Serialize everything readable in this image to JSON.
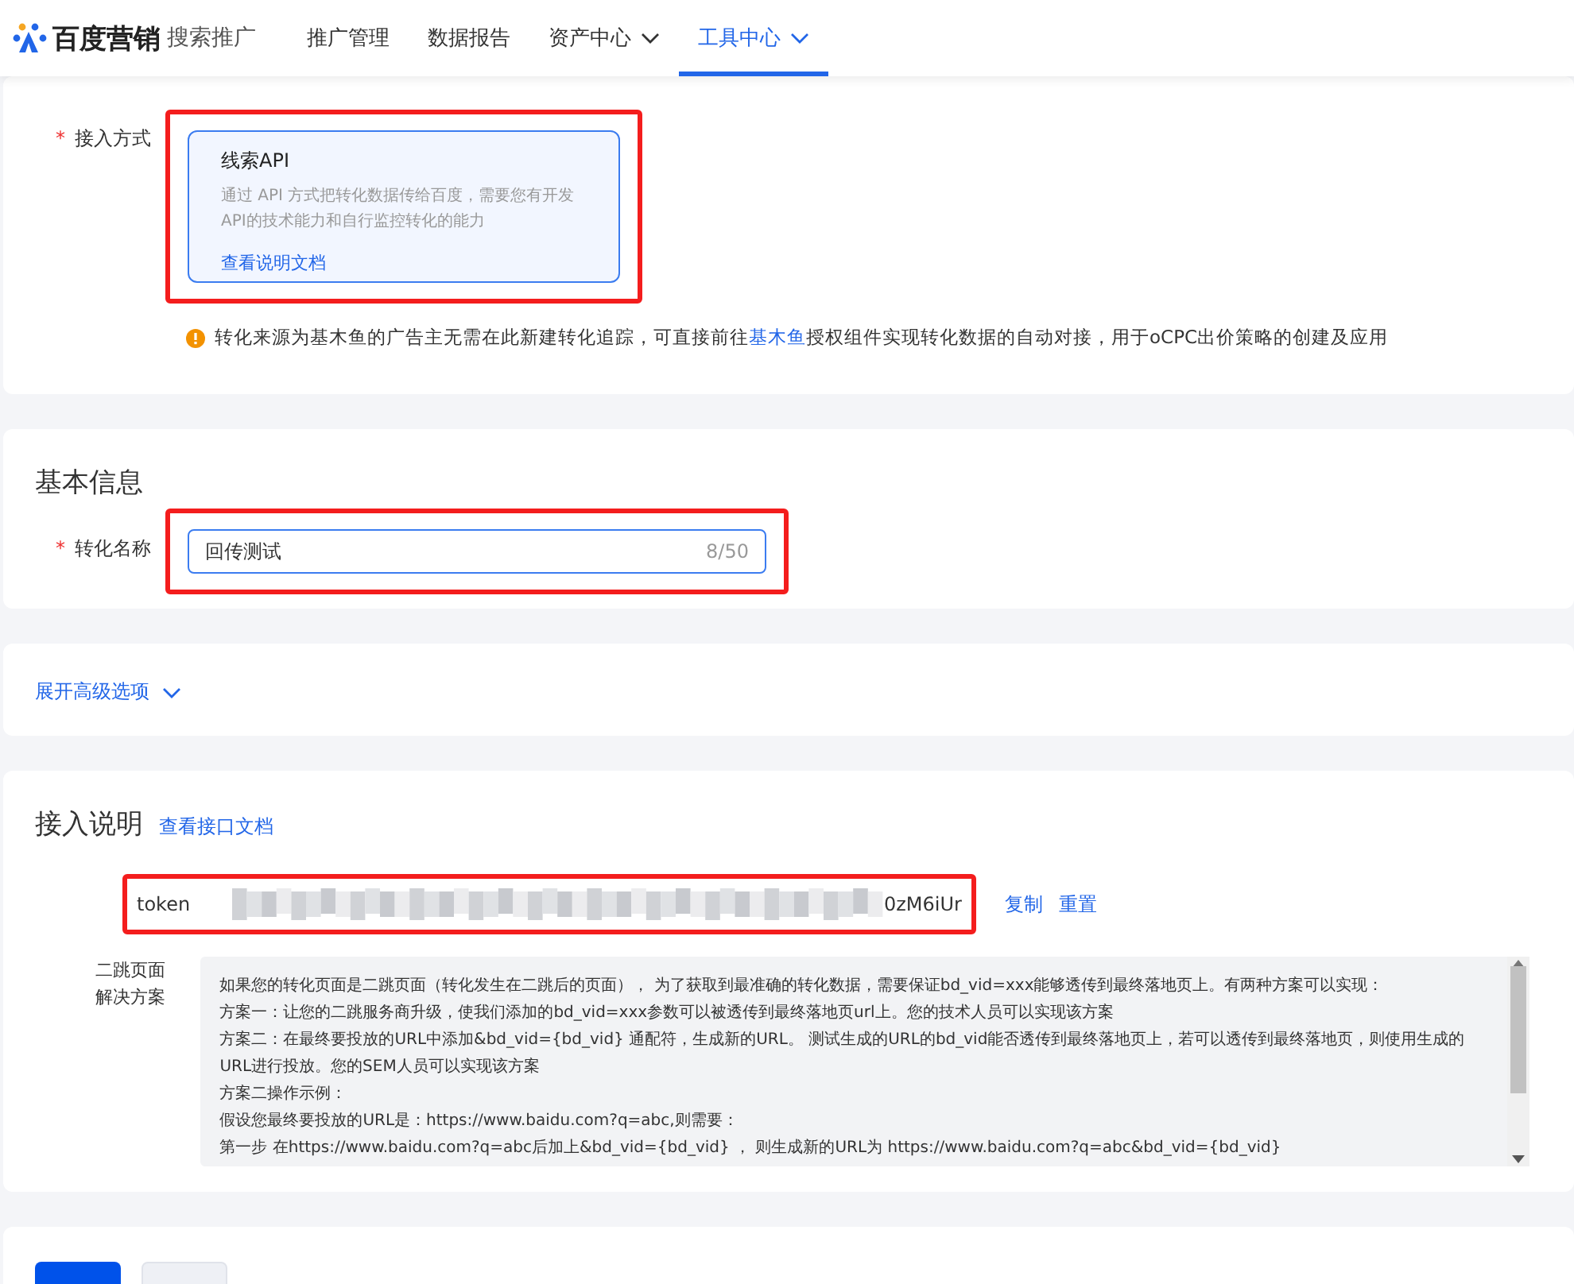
{
  "header": {
    "brand": "百度营销",
    "product": "搜索推广",
    "nav": [
      {
        "label": "推广管理",
        "selected": false,
        "dropdown": false
      },
      {
        "label": "数据报告",
        "selected": false,
        "dropdown": false
      },
      {
        "label": "资产中心",
        "selected": false,
        "dropdown": true
      },
      {
        "label": "工具中心",
        "selected": true,
        "dropdown": true
      }
    ]
  },
  "access": {
    "label": "接入方式",
    "required_mark": "*",
    "option": {
      "title": "线索API",
      "description": "通过 API 方式把转化数据传给百度，需要您有开发API的技术能力和自行监控转化的能力",
      "link": "查看说明文档",
      "selected": true,
      "highlighted": true
    },
    "notice": {
      "before": "转化来源为基木鱼的广告主无需在此新建转化追踪，可直接前往",
      "link": "基木鱼",
      "after": "授权组件实现转化数据的自动对接，用于oCPC出价策略的创建及应用"
    }
  },
  "basic": {
    "title": "基本信息",
    "label": "转化名称",
    "required_mark": "*",
    "value": "回传测试",
    "count": "8/50",
    "highlighted": true
  },
  "advanced": {
    "link": "展开高级选项"
  },
  "instructions": {
    "title": "接入说明",
    "doc_link": "查看接口文档",
    "token": {
      "label": "token",
      "value_tail": "0zM6iUr",
      "highlighted": true
    },
    "actions": [
      "复制",
      "重置"
    ],
    "solution_label": "二跳页面解决方案",
    "lines": [
      "如果您的转化页面是二跳页面（转化发生在二跳后的页面）， 为了获取到最准确的转化数据，需要保证bd_vid=xxx能够透传到最终落地页上。有两种方案可以实现：",
      "方案一：让您的二跳服务商升级，使我们添加的bd_vid=xxx参数可以被透传到最终落地页url上。您的技术人员可以实现该方案",
      "方案二：在最终要投放的URL中添加&bd_vid={bd_vid} 通配符，生成新的URL。 测试生成的URL的bd_vid能否透传到最终落地页上，若可以透传到最终落地页，则使用生成的URL进行投放。您的SEM人员可以实现该方案",
      "方案二操作示例：",
      "假设您最终要投放的URL是：https://www.baidu.com?q=abc,则需要：",
      "第一步 在https://www.baidu.com?q=abc后加上&bd_vid={bd_vid} ， 则生成新的URL为 https://www.baidu.com?q=abc&bd_vid={bd_vid}"
    ]
  },
  "footer": {
    "buttons": [
      {
        "kind": "primary"
      },
      {
        "kind": "secondary"
      }
    ]
  }
}
